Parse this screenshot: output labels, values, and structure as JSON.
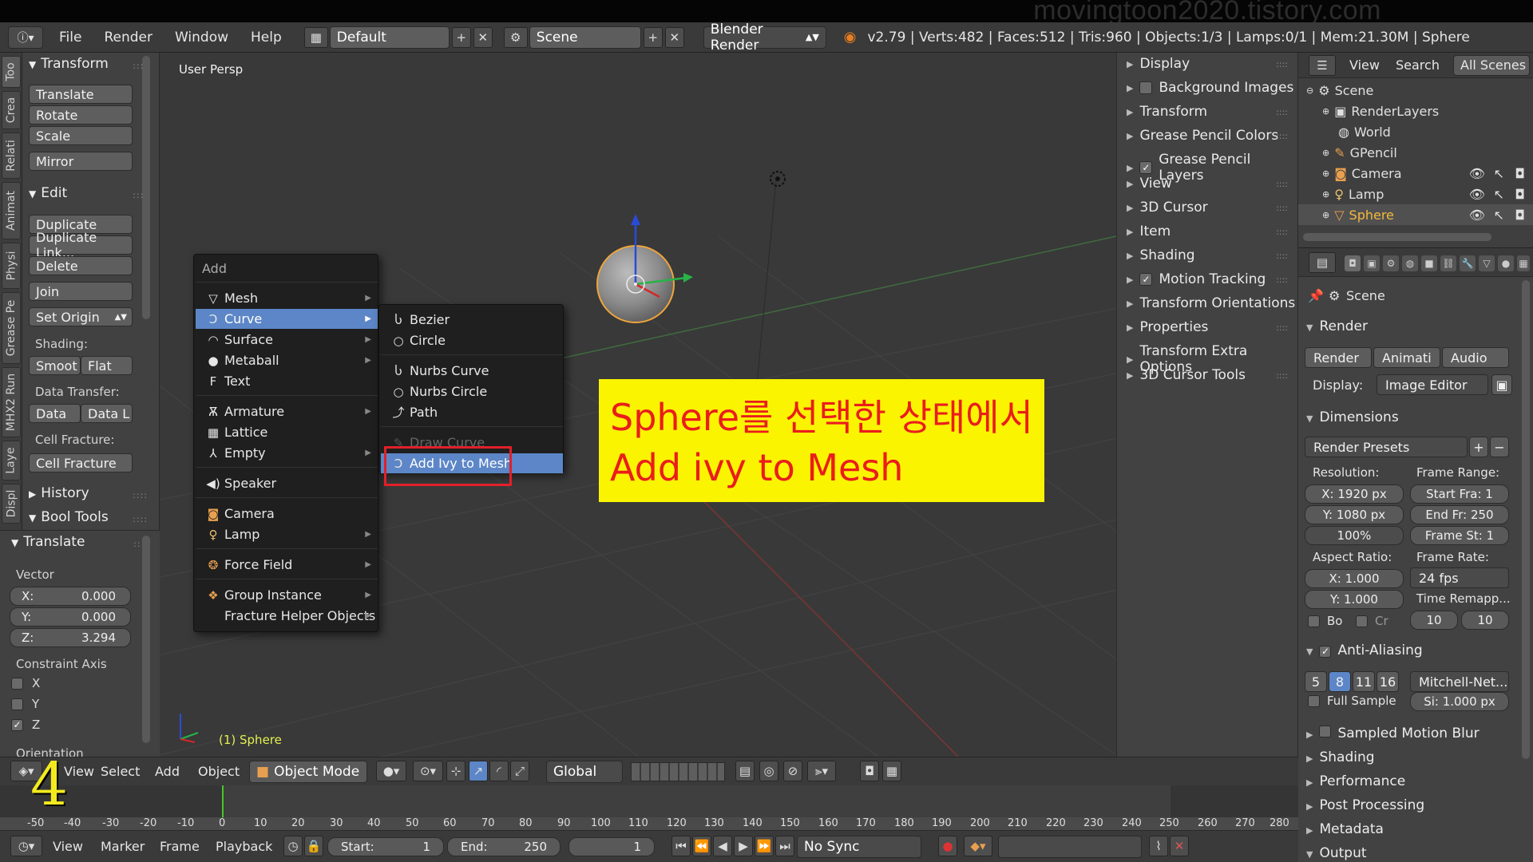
{
  "watermark": "movingtoon2020.tistory.com",
  "infobar": {
    "menus": [
      "File",
      "Render",
      "Window",
      "Help"
    ],
    "layout": "Default",
    "scene": "Scene",
    "engine": "Blender Render",
    "stats": "v2.79 | Verts:482 | Faces:512 | Tris:960 | Objects:1/3 | Lamps:0/1 | Mem:21.30M | Sphere"
  },
  "vtabs": [
    "Too",
    "Crea",
    "Relati",
    "Animat",
    "Physi",
    "Grease Pe",
    "MHX2 Run",
    "Laye",
    "Displ"
  ],
  "toolshelf": {
    "transform_header": "Transform",
    "translate": "Translate",
    "rotate": "Rotate",
    "scale": "Scale",
    "mirror": "Mirror",
    "edit_header": "Edit",
    "duplicate": "Duplicate",
    "duplicate_linked": "Duplicate Link...",
    "delete": "Delete",
    "join": "Join",
    "set_origin": "Set Origin",
    "shading_label": "Shading:",
    "smooth": "Smoot",
    "flat": "Flat",
    "data_transfer_label": "Data Transfer:",
    "data": "Data",
    "data_l": "Data L",
    "cell_fracture_label": "Cell Fracture:",
    "cell_fracture": "Cell Fracture",
    "history": "History",
    "bool_tools": "Bool Tools",
    "op_header": "Translate",
    "vector_label": "Vector",
    "x_label": "X:",
    "x_value": "0.000",
    "y_label": "Y:",
    "y_value": "0.000",
    "z_label": "Z:",
    "z_value": "3.294",
    "constraint_label": "Constraint Axis",
    "axis_x": "X",
    "axis_y": "Y",
    "axis_z": "Z",
    "orientation_label": "Orientation"
  },
  "viewport": {
    "title": "User Persp",
    "object_label": "(1) Sphere"
  },
  "addmenu": {
    "title": "Add",
    "items": [
      "Mesh",
      "Curve",
      "Surface",
      "Metaball",
      "Text",
      "Armature",
      "Lattice",
      "Empty",
      "Speaker",
      "Camera",
      "Lamp",
      "Force Field",
      "Group Instance",
      "Fracture Helper Objects"
    ],
    "curve_items": [
      "Bezier",
      "Circle",
      "Nurbs Curve",
      "Nurbs Circle",
      "Path",
      "Draw Curve",
      "Add Ivy to Mesh"
    ]
  },
  "annotation": {
    "line1": "Sphere를 선택한 상태에서",
    "line2": "Add ivy to Mesh"
  },
  "npanel": [
    "Display",
    "Background Images",
    "Transform",
    "Grease Pencil Colors",
    "Grease Pencil Layers",
    "View",
    "3D Cursor",
    "Item",
    "Shading",
    "Motion Tracking",
    "Transform Orientations",
    "Properties",
    "Transform Extra Options",
    "3D Cursor Tools"
  ],
  "outliner": {
    "view": "View",
    "search": "Search",
    "filter": "All Scenes",
    "rows": [
      "Scene",
      "RenderLayers",
      "World",
      "GPencil",
      "Camera",
      "Lamp",
      "Sphere"
    ]
  },
  "props": {
    "context": "Scene",
    "render_header": "Render",
    "render_btn": "Render",
    "anim_btn": "Animati",
    "audio_btn": "Audio",
    "display_label": "Display:",
    "display_value": "Image Editor",
    "dimensions_header": "Dimensions",
    "presets": "Render Presets",
    "resolution_label": "Resolution:",
    "res_x": "X:  1920 px",
    "res_y": "Y:  1080 px",
    "res_pct": "100%",
    "frame_range_label": "Frame Range:",
    "start": "Start Fra: 1",
    "end": "End Fr: 250",
    "step": "Frame St: 1",
    "aspect_label": "Aspect Ratio:",
    "asp_x": "X:      1.000",
    "asp_y": "Y:      1.000",
    "frame_rate_label": "Frame Rate:",
    "fps": "24 fps",
    "remap_label": "Time Remapp...",
    "remap_old": "10",
    "remap_new": "10",
    "bo": "Bo",
    "cr": "Cr",
    "aa_header": "Anti-Aliasing",
    "aa_values": [
      "5",
      "8",
      "11",
      "16"
    ],
    "filter": "Mitchell-Net...",
    "full_sample": "Full Sample",
    "filter_size": "Si: 1.000 px",
    "sections": [
      "Sampled Motion Blur",
      "Shading",
      "Performance",
      "Post Processing",
      "Metadata",
      "Output"
    ]
  },
  "vphead": {
    "view": "View",
    "select": "Select",
    "add": "Add",
    "object": "Object",
    "mode": "Object Mode",
    "orientation": "Global"
  },
  "ruler": [
    "-50",
    "-40",
    "-30",
    "-20",
    "-10",
    "0",
    "10",
    "20",
    "30",
    "40",
    "50",
    "60",
    "70",
    "80",
    "90",
    "100",
    "110",
    "120",
    "130",
    "140",
    "150",
    "160",
    "170",
    "180",
    "190",
    "200",
    "210",
    "220",
    "230",
    "240",
    "250",
    "260",
    "270",
    "280"
  ],
  "tlhead": {
    "view": "View",
    "marker": "Marker",
    "frame": "Frame",
    "playback": "Playback",
    "start_label": "Start:",
    "start_val": "1",
    "end_label": "End:",
    "end_val": "250",
    "current": "1",
    "sync": "No Sync"
  },
  "step_number": "4"
}
